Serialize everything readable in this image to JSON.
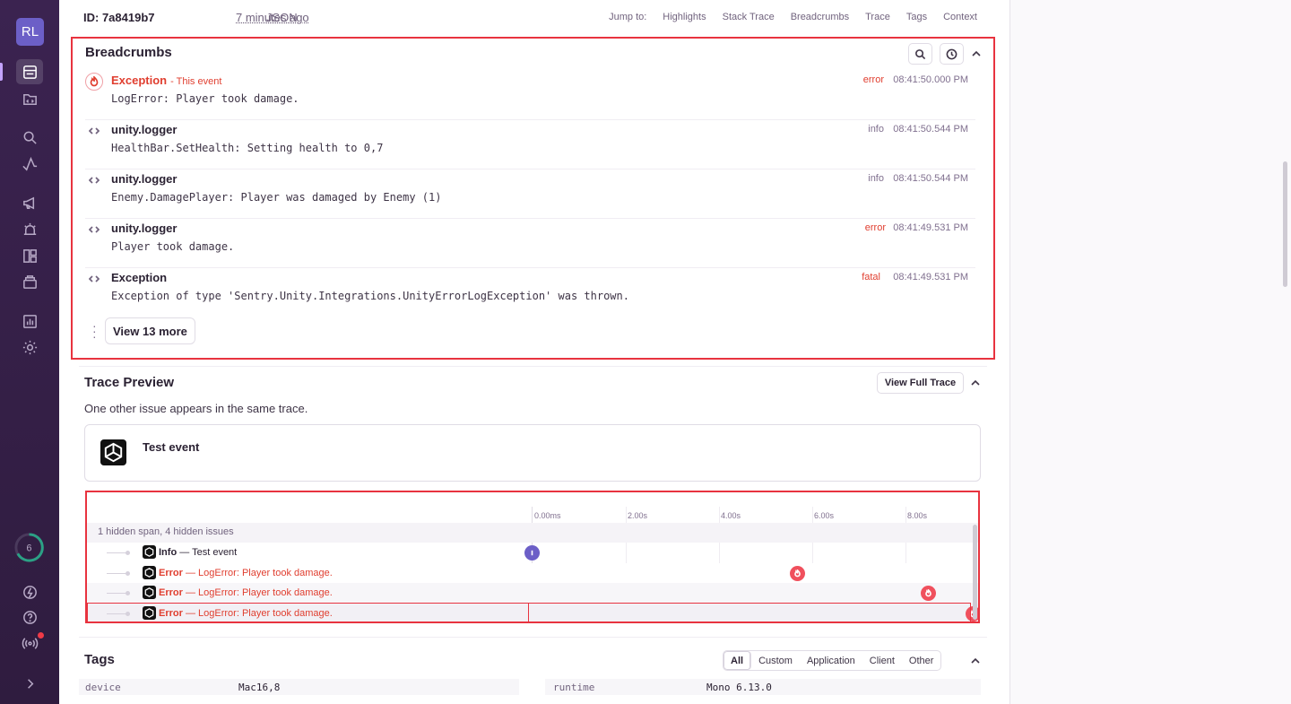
{
  "sidebar": {
    "avatar_initials": "RL",
    "onboarding_count": "6",
    "items": [
      {
        "name": "issues-icon"
      },
      {
        "name": "projects-icon"
      },
      {
        "name": "explore-icon"
      },
      {
        "name": "performance-icon"
      },
      {
        "name": "releases-icon"
      },
      {
        "name": "alerts-icon"
      },
      {
        "name": "dashboards-icon"
      },
      {
        "name": "archive-icon"
      },
      {
        "name": "stats-icon"
      },
      {
        "name": "settings-icon"
      }
    ],
    "accent_color": "#6c5fc7"
  },
  "header": {
    "event_id": "ID: 7a8419b7",
    "time_ago": "7 minutes ago",
    "json_link": "JSON",
    "jump_to_label": "Jump to:",
    "jump_links": [
      "Highlights",
      "Stack Trace",
      "Breadcrumbs",
      "Trace",
      "Tags",
      "Context"
    ]
  },
  "breadcrumbs": {
    "title": "Breadcrumbs",
    "items": [
      {
        "category": "Exception",
        "note": "- This event",
        "message": "LogError: Player took damage.",
        "level": "error",
        "time": "08:41:50.000 PM"
      },
      {
        "category": "unity.logger",
        "note": "",
        "message": "HealthBar.SetHealth: Setting health to 0,7",
        "level": "info",
        "time": "08:41:50.544 PM"
      },
      {
        "category": "unity.logger",
        "note": "",
        "message": "Enemy.DamagePlayer: Player was damaged by Enemy (1)",
        "level": "info",
        "time": "08:41:50.544 PM"
      },
      {
        "category": "unity.logger",
        "note": "",
        "message": "Player took damage.",
        "level": "error",
        "time": "08:41:49.531 PM"
      },
      {
        "category": "Exception",
        "note": "",
        "message": "Exception of type 'Sentry.Unity.Integrations.UnityErrorLogException' was thrown.",
        "level": "fatal",
        "time": "08:41:49.531 PM"
      }
    ],
    "view_more": "View 13 more"
  },
  "trace": {
    "title": "Trace Preview",
    "subtitle": "One other issue appears in the same trace.",
    "view_full_button": "View Full Trace",
    "issue_card_title": "Test event",
    "ticks": [
      "0.00ms",
      "2.00s",
      "4.00s",
      "6.00s",
      "8.00s"
    ],
    "hidden_summary": "1 hidden span, 4 hidden issues",
    "rows": [
      {
        "kind": "Info",
        "separator": " — ",
        "text": "Test event",
        "status": "info"
      },
      {
        "kind": "Error",
        "separator": " — ",
        "text": "LogError: Player took damage.",
        "status": "error"
      },
      {
        "kind": "Error",
        "separator": " — ",
        "text": "LogError: Player took damage.",
        "status": "error"
      },
      {
        "kind": "Error",
        "separator": " — ",
        "text": "LogError: Player took damage.",
        "status": "error"
      }
    ],
    "error_color": "#e03e2f"
  },
  "tags": {
    "title": "Tags",
    "filters": [
      "All",
      "Custom",
      "Application",
      "Client",
      "Other"
    ],
    "selected_filter": "All",
    "left": [
      {
        "key": "device",
        "value": "Mac16,8"
      }
    ],
    "right": [
      {
        "key": "runtime",
        "value": "Mono 6.13.0"
      }
    ]
  }
}
